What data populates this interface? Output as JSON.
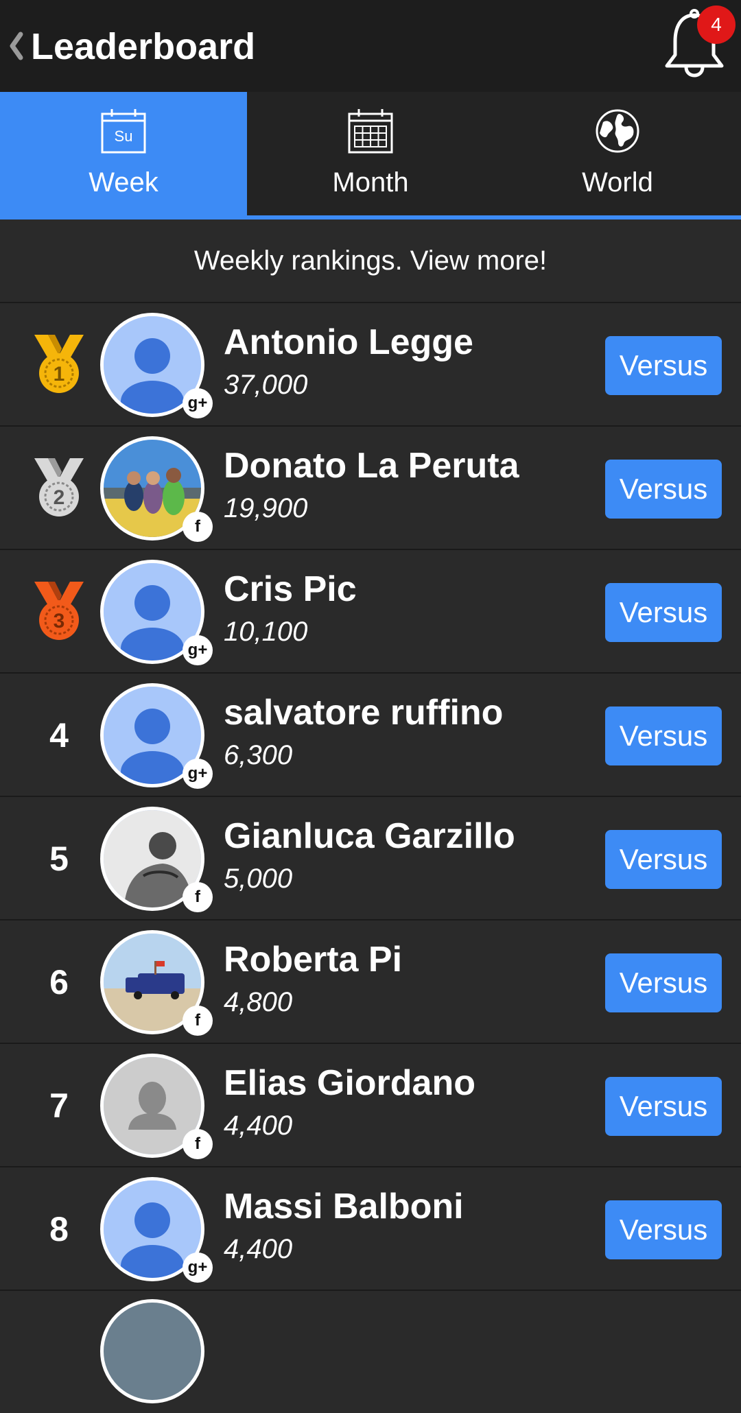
{
  "header": {
    "title": "Leaderboard",
    "back_icon": "chevron-left-icon",
    "bell_icon": "bell-icon",
    "notification_count": "4"
  },
  "tabs": [
    {
      "label": "Week",
      "icon": "calendar-week-icon",
      "icon_text": "Su",
      "active": true
    },
    {
      "label": "Month",
      "icon": "calendar-month-icon",
      "active": false
    },
    {
      "label": "World",
      "icon": "globe-icon",
      "active": false
    }
  ],
  "banner": {
    "text": "Weekly rankings. View more!"
  },
  "colors": {
    "accent": "#3d8bf5",
    "background": "#2a2a2a",
    "header": "#1d1d1d",
    "badge": "#e01818",
    "gold": "#f5b50a",
    "silver": "#d8d8d8",
    "bronze": "#f25a1a"
  },
  "players": [
    {
      "rank": "1",
      "medal": "gold",
      "name": "Antonio Legge",
      "score": "37,000",
      "social": "g+",
      "avatar": "default-avatar",
      "action": "Versus"
    },
    {
      "rank": "2",
      "medal": "silver",
      "name": "Donato La Peruta",
      "score": "19,900",
      "social": "f",
      "avatar": "photo-group",
      "action": "Versus"
    },
    {
      "rank": "3",
      "medal": "bronze",
      "name": "Cris Pic",
      "score": "10,100",
      "social": "g+",
      "avatar": "default-avatar",
      "action": "Versus"
    },
    {
      "rank": "4",
      "medal": "",
      "name": "salvatore ruffino",
      "score": "6,300",
      "social": "g+",
      "avatar": "default-avatar",
      "action": "Versus"
    },
    {
      "rank": "5",
      "medal": "",
      "name": "Gianluca Garzillo",
      "score": "5,000",
      "social": "f",
      "avatar": "photo-bw-portrait",
      "action": "Versus"
    },
    {
      "rank": "6",
      "medal": "",
      "name": "Roberta Pi",
      "score": "4,800",
      "social": "f",
      "avatar": "photo-beach-van",
      "action": "Versus"
    },
    {
      "rank": "7",
      "medal": "",
      "name": "Elias Giordano",
      "score": "4,400",
      "social": "f",
      "avatar": "facebook-default-avatar",
      "action": "Versus"
    },
    {
      "rank": "8",
      "medal": "",
      "name": "Massi Balboni",
      "score": "4,400",
      "social": "g+",
      "avatar": "default-avatar",
      "action": "Versus"
    }
  ]
}
